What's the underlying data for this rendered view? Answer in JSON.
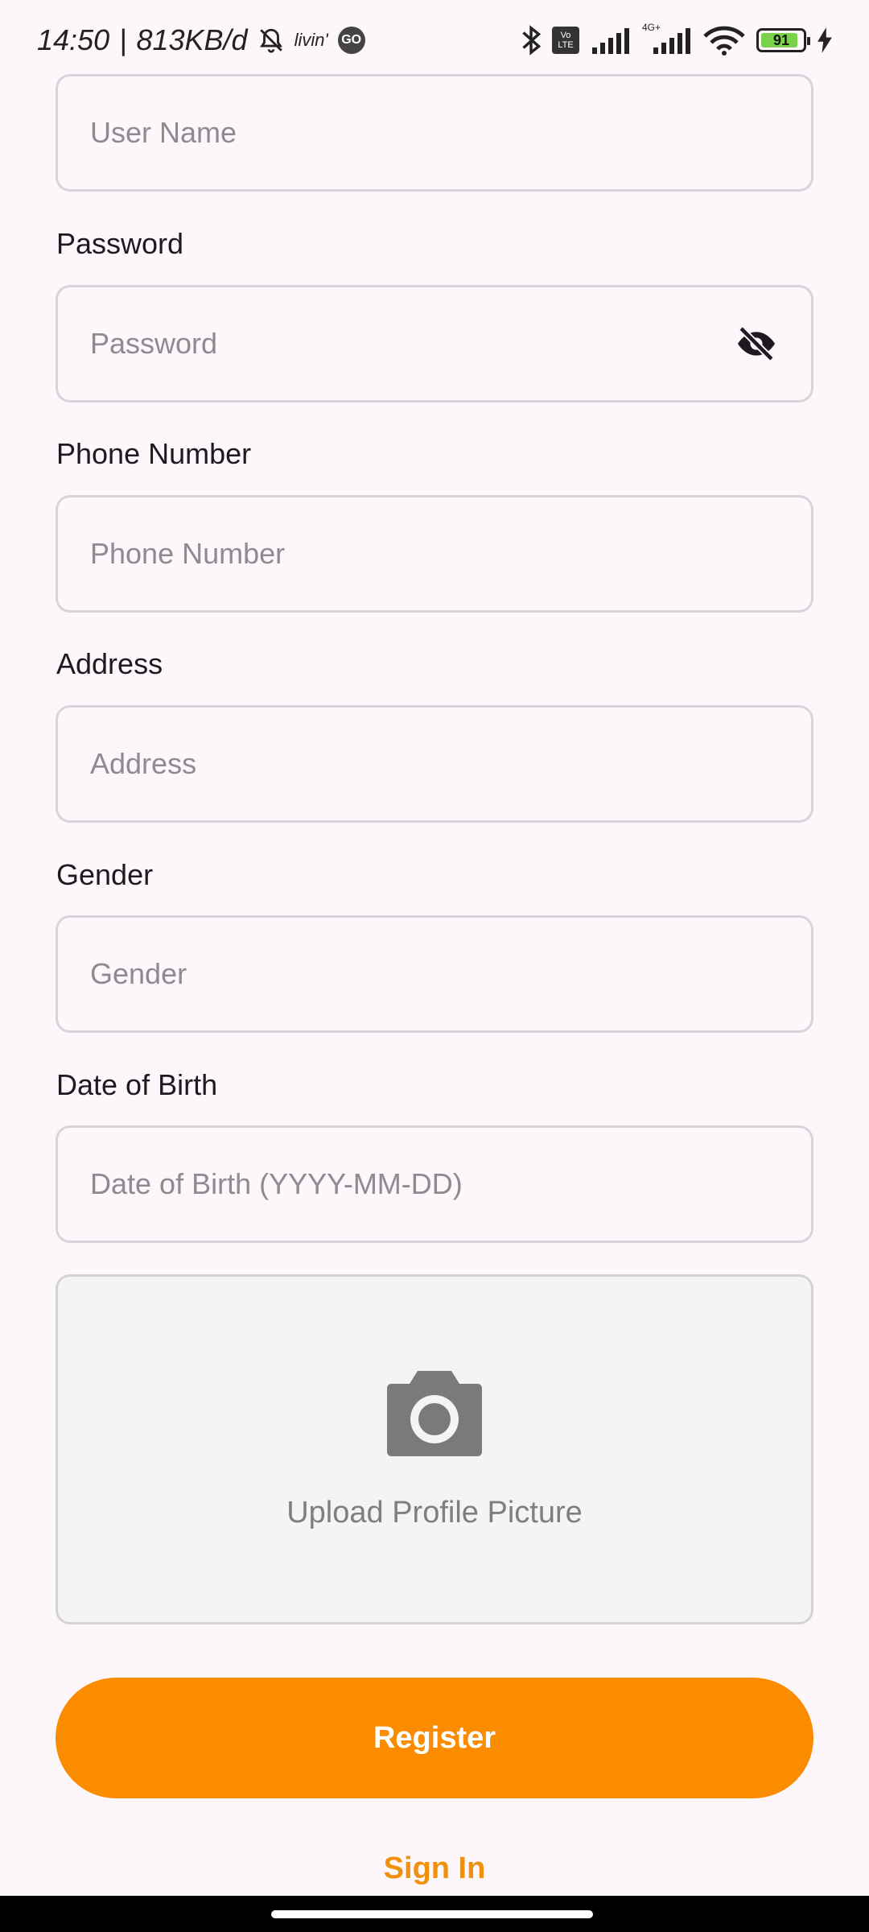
{
  "status_bar": {
    "time": "14:50",
    "separator": "|",
    "net_speed": "813KB/d",
    "app_badge": "livin'",
    "go_badge": "GO",
    "volte": "Vo LTE",
    "network": "4G+",
    "battery_level": "91",
    "battery_fraction": 0.91
  },
  "form": {
    "username_placeholder": "User Name",
    "password_label": "Password",
    "password_placeholder": "Password",
    "phone_label": "Phone Number",
    "phone_placeholder": "Phone Number",
    "address_label": "Address",
    "address_placeholder": "Address",
    "gender_label": "Gender",
    "gender_placeholder": "Gender",
    "dob_label": "Date of Birth",
    "dob_placeholder": "Date of Birth (YYYY-MM-DD)"
  },
  "upload": {
    "label": "Upload Profile Picture",
    "icon": "camera-icon"
  },
  "actions": {
    "register_label": "Register",
    "signin_label": "Sign In"
  },
  "colors": {
    "accent": "#fb8c00",
    "link": "#f0900d",
    "background": "#fdf7fc"
  }
}
